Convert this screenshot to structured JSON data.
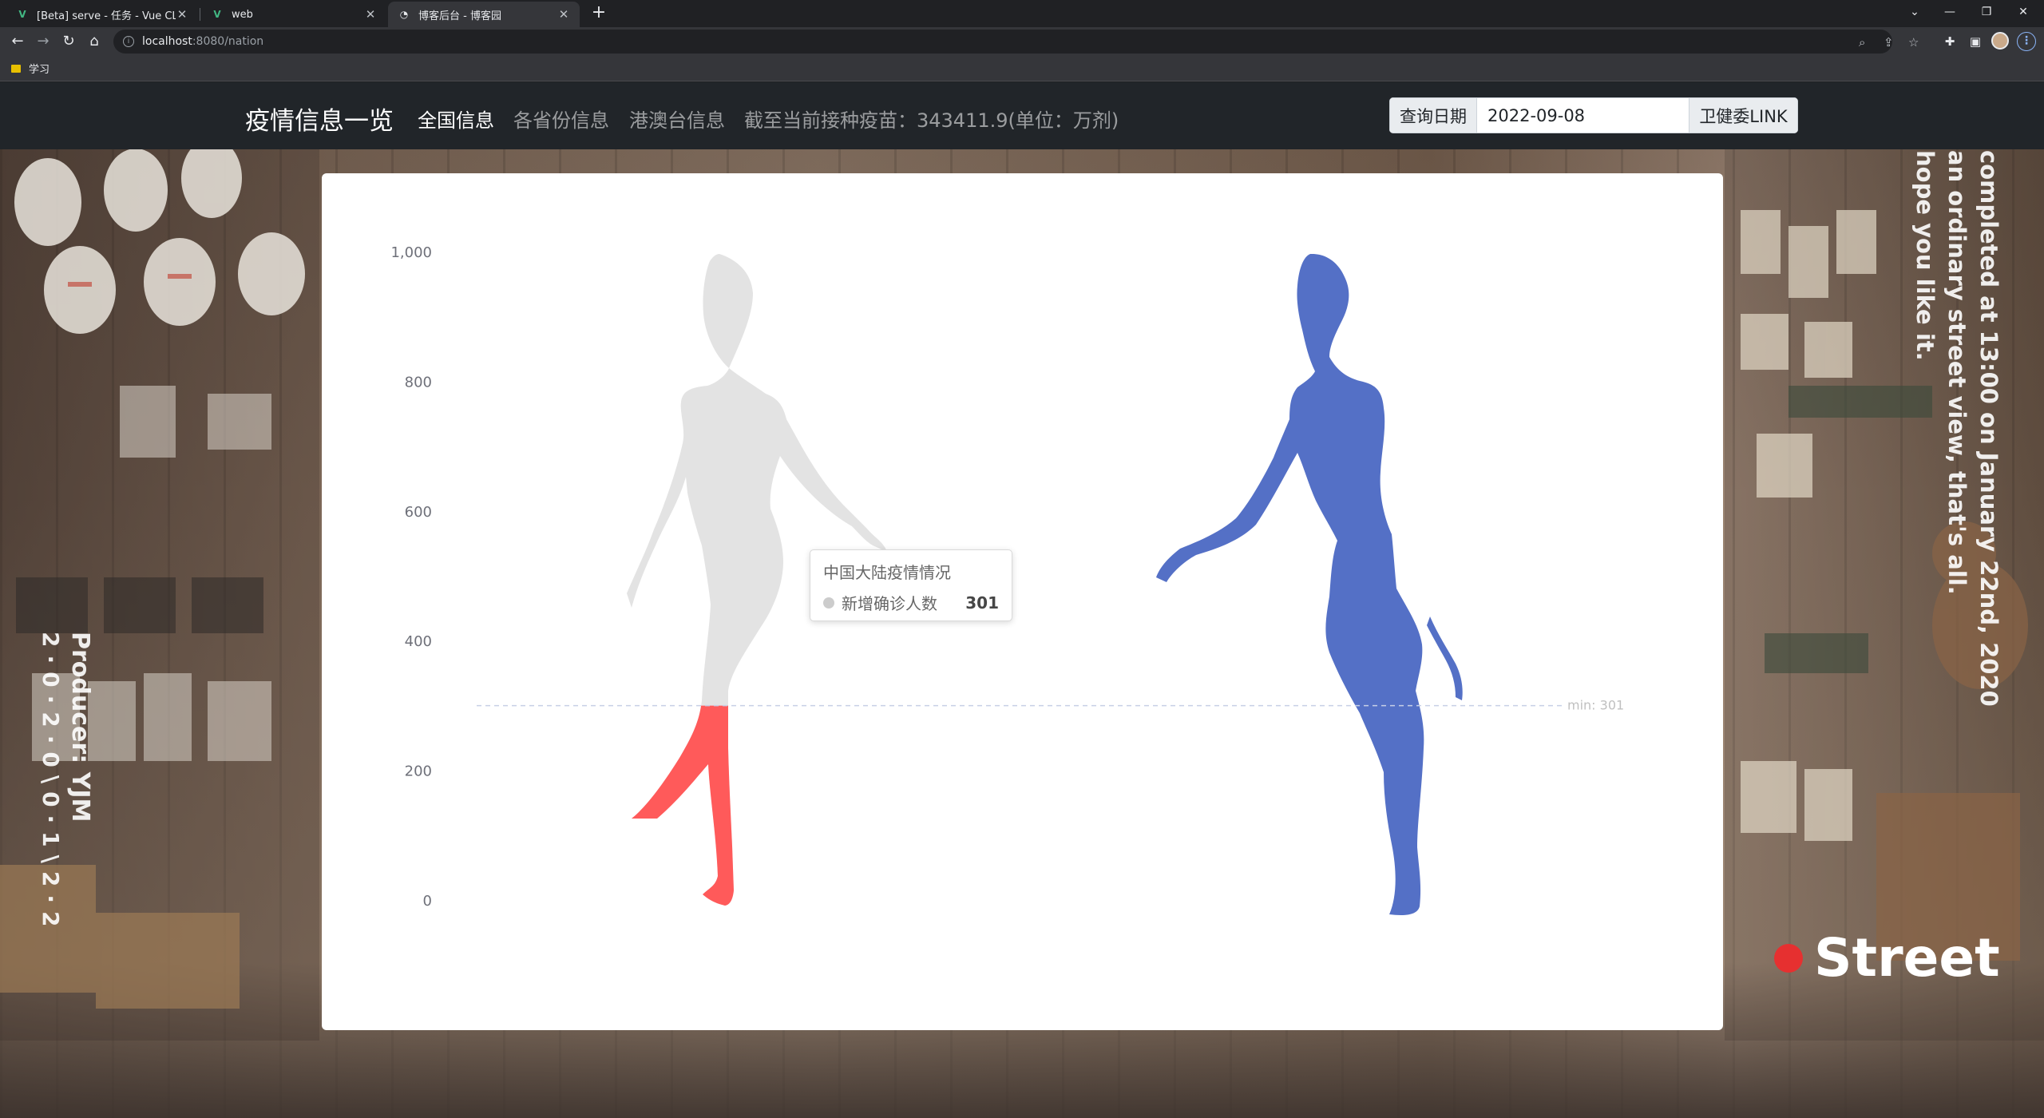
{
  "browser": {
    "tabs": [
      {
        "title": "[Beta] serve - 任务 - Vue CLI",
        "icon": "vue-icon"
      },
      {
        "title": "web",
        "icon": "vue-icon"
      },
      {
        "title": "博客后台 - 博客园",
        "icon": "blog-icon"
      }
    ],
    "active_tab_index": 2,
    "url_host": "localhost",
    "url_path": ":8080/nation",
    "bookmark_folder": "学习"
  },
  "nav": {
    "brand": "疫情信息一览",
    "links": [
      "全国信息",
      "各省份信息",
      "港澳台信息"
    ],
    "active_link_index": 0,
    "vaccine_text": "截至当前接种疫苗：343411.9(单位：万剂)",
    "date_label": "查询日期",
    "date_value": "2022-09-08",
    "nhc_link": "卫健委LINK"
  },
  "background_text": {
    "producer": "Producer: YJM",
    "producer_date": "2·0·2·0\\0·1\\2·2",
    "caption_lines": [
      "completed at 13:00 on January 22nd, 2020",
      "an ordinary street view, that's all.",
      "hope you like it."
    ],
    "street": "Street"
  },
  "chart_data": {
    "type": "pictorial-bar",
    "ylim": [
      0,
      1000
    ],
    "y_ticks": [
      "0",
      "200",
      "400",
      "600",
      "800",
      "1,000"
    ],
    "series": [
      {
        "name": "新增确诊人数",
        "value": 301,
        "max": 1000,
        "fill_color": "#ff5a5a",
        "track_color": "#e3e3e3"
      },
      {
        "value": 1000,
        "fill_color": "#5470c6"
      }
    ],
    "mark_line": {
      "label": "min: 301",
      "value": 301
    },
    "tooltip": {
      "title": "中国大陆疫情情况",
      "series_name": "新增确诊人数",
      "value": "301"
    },
    "grid": false,
    "colors": {
      "highlight": "#ff5a5a",
      "track": "#e3e3e3",
      "figure_blue": "#5470c6",
      "axis_text": "#6e7079"
    }
  }
}
